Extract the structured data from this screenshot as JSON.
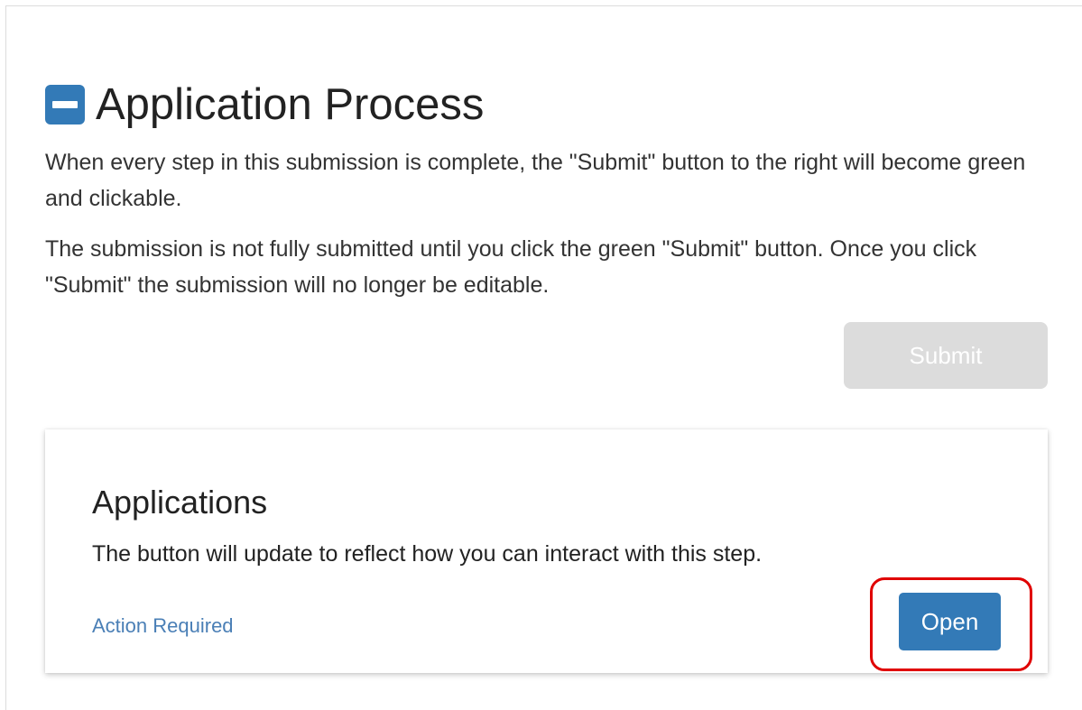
{
  "section": {
    "title": "Application Process",
    "collapse_icon": "minus-square-icon",
    "intro": [
      "When every step in this submission is complete, the \"Submit\" button to the right will become green and clickable.",
      "The submission is not fully submitted until you click the green \"Submit\" button. Once you click \"Submit\" the submission will no longer be editable."
    ],
    "submit_label": "Submit",
    "submit_state": "disabled"
  },
  "card": {
    "title": "Applications",
    "description": "The button will update to reflect how you can interact with this step.",
    "status": "Action Required",
    "open_label": "Open"
  },
  "colors": {
    "primary": "#337ab7",
    "disabled": "#dcdcdc",
    "link": "#4a7fb6",
    "highlight": "#e00000"
  }
}
